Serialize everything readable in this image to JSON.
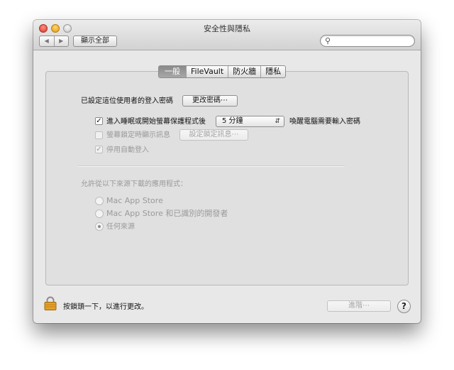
{
  "window": {
    "title": "安全性與隱私"
  },
  "toolbar": {
    "back_icon": "◀",
    "forward_icon": "▶",
    "show_all_label": "顯示全部",
    "search_placeholder": "",
    "search_icon": "🔍"
  },
  "tabs": [
    {
      "label": "一般",
      "selected": true
    },
    {
      "label": "FileVault",
      "selected": false
    },
    {
      "label": "防火牆",
      "selected": false
    },
    {
      "label": "隱私",
      "selected": false
    }
  ],
  "general": {
    "login_password_label": "已設定這位使用者的登入密碼",
    "change_password_button": "更改密碼⋯",
    "require_password": {
      "checked": true,
      "check_mark": "✓",
      "label": "進入睡眠或開始螢幕保護程式後",
      "delay_value": "5 分鐘",
      "suffix": "喚醒電腦需要輸入密碼"
    },
    "show_message": {
      "checked": false,
      "label": "螢幕鎖定時顯示訊息",
      "button": "設定鎖定訊息⋯"
    },
    "disable_auto_login": {
      "checked": true,
      "check_mark": "✓",
      "label": "停用自動登入"
    },
    "downloads_label": "允許從以下來源下載的應用程式：",
    "sources": [
      {
        "label": "Mac App Store",
        "selected": false
      },
      {
        "label": "Mac App Store 和已識別的開發者",
        "selected": false
      },
      {
        "label": "任何來源",
        "selected": true
      }
    ]
  },
  "footer": {
    "lock_text": "按鎖頭一下，以進行更改。",
    "advanced_button": "進階⋯",
    "help_label": "?"
  },
  "colors": {
    "close": "#d8392a",
    "minimize": "#e29a16",
    "selected_tab": "#8a8a8a"
  }
}
